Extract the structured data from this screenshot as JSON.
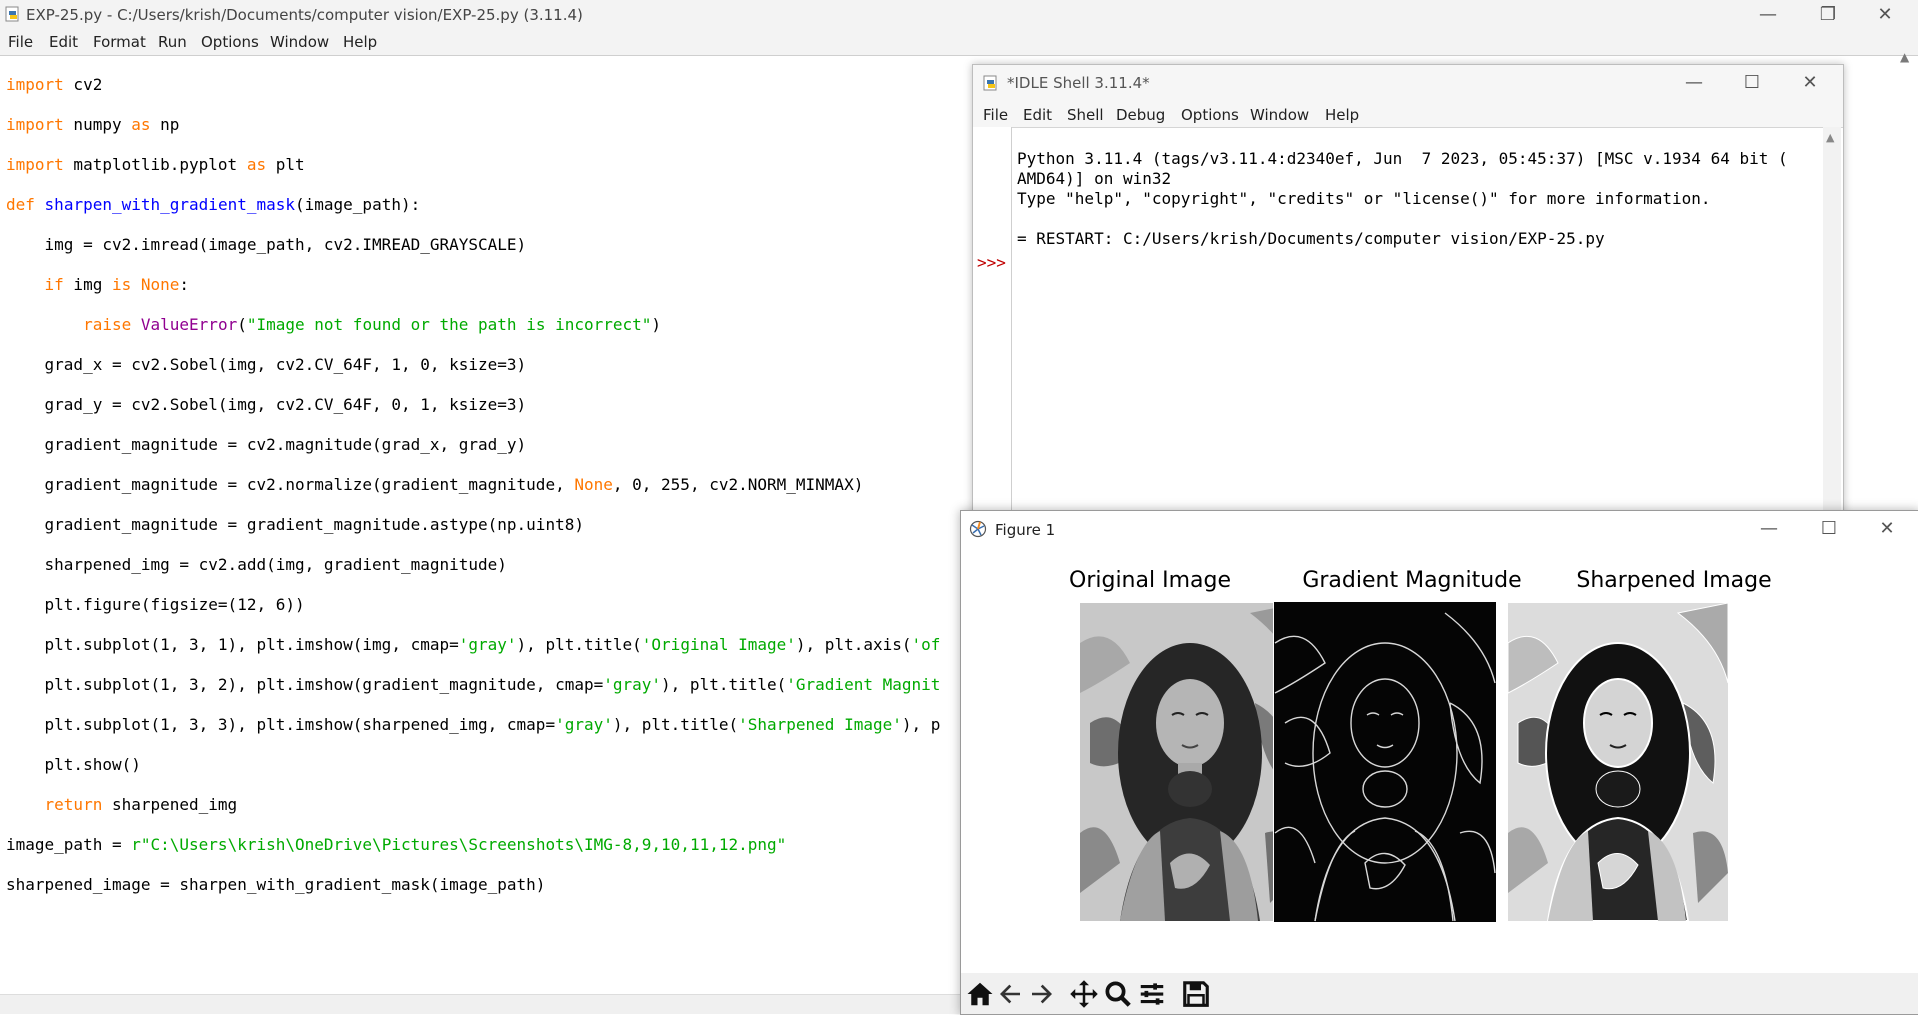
{
  "editor": {
    "title": "EXP-25.py - C:/Users/krish/Documents/computer vision/EXP-25.py (3.11.4)",
    "menu": [
      "File",
      "Edit",
      "Format",
      "Run",
      "Options",
      "Window",
      "Help"
    ],
    "minimize": "—",
    "maximize": "❐",
    "close": "✕",
    "code": {
      "l1": [
        "import",
        " cv2"
      ],
      "l2": [
        "import",
        " numpy ",
        "as",
        " np"
      ],
      "l3": [
        "import",
        " matplotlib.pyplot ",
        "as",
        " plt"
      ],
      "l4": [
        "def",
        " ",
        "sharpen_with_gradient_mask",
        "(image_path):"
      ],
      "l5": "    img = cv2.imread(image_path, cv2.IMREAD_GRAYSCALE)",
      "l6": [
        "    ",
        "if",
        " img ",
        "is",
        " ",
        "None",
        ":"
      ],
      "l7": [
        "        ",
        "raise",
        " ",
        "ValueError",
        "(",
        "\"Image not found or the path is incorrect\"",
        ")"
      ],
      "l8": "    grad_x = cv2.Sobel(img, cv2.CV_64F, 1, 0, ksize=3)",
      "l9": "    grad_y = cv2.Sobel(img, cv2.CV_64F, 0, 1, ksize=3)",
      "l10": "    gradient_magnitude = cv2.magnitude(grad_x, grad_y)",
      "l11": [
        "    gradient_magnitude = cv2.normalize(gradient_magnitude, ",
        "None",
        ", 0, 255, cv2.NORM_MINMAX)"
      ],
      "l12": "    gradient_magnitude = gradient_magnitude.astype(np.uint8)",
      "l13": "    sharpened_img = cv2.add(img, gradient_magnitude)",
      "l14": "    plt.figure(figsize=(12, 6))",
      "l15": [
        "    plt.subplot(1, 3, 1), plt.imshow(img, cmap=",
        "'gray'",
        "), plt.title(",
        "'Original Image'",
        "), plt.axis(",
        "'of"
      ],
      "l16": [
        "    plt.subplot(1, 3, 2), plt.imshow(gradient_magnitude, cmap=",
        "'gray'",
        "), plt.title(",
        "'Gradient Magnit"
      ],
      "l17": [
        "    plt.subplot(1, 3, 3), plt.imshow(sharpened_img, cmap=",
        "'gray'",
        "), plt.title(",
        "'Sharpened Image'",
        "), p"
      ],
      "l18": "    plt.show()",
      "l19": [
        "    ",
        "return",
        " sharpened_img"
      ],
      "l20": [
        "image_path = ",
        "r\"C:\\Users\\krish\\OneDrive\\Pictures\\Screenshots\\IMG-8,9,10,11,12.png\""
      ],
      "l21": "sharpened_image = sharpen_with_gradient_mask(image_path)"
    }
  },
  "shell": {
    "title": "*IDLE Shell 3.11.4*",
    "menu": [
      "File",
      "Edit",
      "Shell",
      "Debug",
      "Options",
      "Window",
      "Help"
    ],
    "prompt": ">>>",
    "lines": [
      "Python 3.11.4 (tags/v3.11.4:d2340ef, Jun  7 2023, 05:45:37) [MSC v.1934 64 bit (",
      "AMD64)] on win32",
      "Type \"help\", \"copyright\", \"credits\" or \"license()\" for more information.",
      "",
      "= RESTART: C:/Users/krish/Documents/computer vision/EXP-25.py"
    ],
    "minimize": "—",
    "maximize": "☐",
    "close": "✕"
  },
  "figure": {
    "title": "Figure 1",
    "panels": [
      "Original Image",
      "Gradient Magnitude",
      "Sharpened Image"
    ],
    "minimize": "—",
    "maximize": "☐",
    "close": "✕",
    "toolbar_icons": [
      "home-icon",
      "back-arrow-icon",
      "forward-arrow-icon",
      "pan-icon",
      "zoom-icon",
      "configure-subplots-icon",
      "save-icon"
    ]
  },
  "colors": {
    "keyword": "#ff7700",
    "function_def": "#0000ff",
    "builtin": "#900090",
    "string": "#00aa00",
    "prompt": "#c00000"
  }
}
